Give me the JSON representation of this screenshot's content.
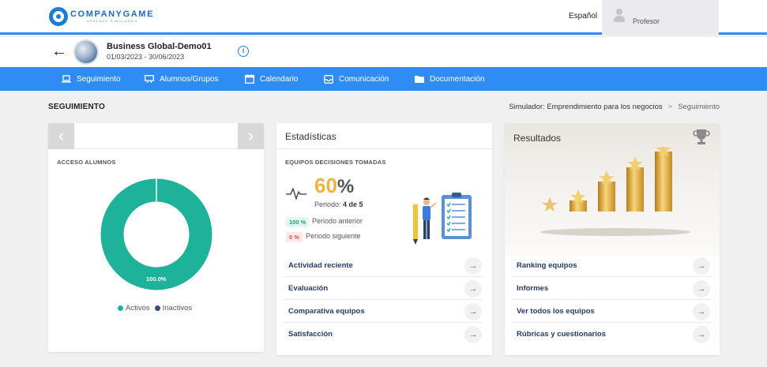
{
  "header": {
    "logo_text": "COMPANYGAME",
    "logo_tagline": "APRENDE SIMULANDO",
    "language": "Español",
    "user_name": "Profesor"
  },
  "course": {
    "title": "Business Global-Demo01",
    "dates": "01/03/2023 - 30/06/2023"
  },
  "nav": {
    "items": [
      {
        "label": "Seguimiento",
        "icon": "laptop-icon"
      },
      {
        "label": "Alumnos/Grupos",
        "icon": "users-board-icon"
      },
      {
        "label": "Calendario",
        "icon": "calendar-icon"
      },
      {
        "label": "Comunicación",
        "icon": "inbox-icon"
      },
      {
        "label": "Documentación",
        "icon": "folder-icon"
      }
    ]
  },
  "page": {
    "title": "SEGUIMIENTO",
    "breadcrumb": {
      "parent": "Simulador: Emprendimiento para los negocios",
      "separator": ">",
      "current": "Seguimiento"
    }
  },
  "access_card": {
    "label": "ACCESO ALUMNOS",
    "active_share": 100.0,
    "donut_label": "100.0%",
    "legend": [
      {
        "label": "Activos",
        "color": "#1fb29a"
      },
      {
        "label": "Inactivos",
        "color": "#3c4a86"
      }
    ]
  },
  "stats_card": {
    "title": "Estadísticas",
    "section_label": "EQUIPOS DECISIONES TOMADAS",
    "percent_value": "60",
    "percent_symbol": "%",
    "period_prefix": "Periodo:",
    "period_value": "4 de 5",
    "prev_badge": "100 %",
    "prev_label": "Periodo anterior",
    "next_badge": "0 %",
    "next_label": "Periodo siguiente",
    "links": [
      {
        "label": "Actividad reciente"
      },
      {
        "label": "Evaluación"
      },
      {
        "label": "Comparativa equipos"
      },
      {
        "label": "Satisfacción"
      }
    ]
  },
  "results_card": {
    "title": "Resultados",
    "links": [
      {
        "label": "Ranking equipos"
      },
      {
        "label": "Informes"
      },
      {
        "label": "Ver todos los equipos"
      },
      {
        "label": "Rúbricas y cuestionarios"
      }
    ]
  },
  "colors": {
    "primary": "#2f8cf5",
    "teal": "#1fb29a",
    "navy": "#263a64",
    "gold": "#f0b23c",
    "red": "#e2533f"
  }
}
